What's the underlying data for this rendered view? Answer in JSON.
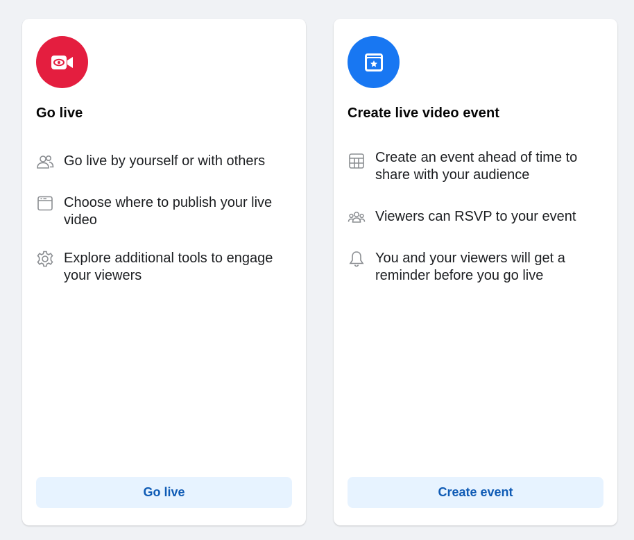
{
  "colors": {
    "page_bg": "#f0f2f5",
    "card_bg": "#ffffff",
    "go_live_accent": "#e41e3f",
    "event_accent": "#1877f2",
    "button_bg": "#e7f3ff",
    "button_text": "#0f5bb5",
    "feature_icon": "#8a8d91"
  },
  "go_live_card": {
    "icon": "video-camera-icon",
    "title": "Go live",
    "features": [
      {
        "icon": "people-icon",
        "text": "Go live by yourself or with others"
      },
      {
        "icon": "browser-window-icon",
        "text": "Choose where to publish your live video"
      },
      {
        "icon": "gear-icon",
        "text": "Explore additional tools to engage your viewers"
      }
    ],
    "button_label": "Go live"
  },
  "event_card": {
    "icon": "calendar-star-icon",
    "title": "Create live video event",
    "features": [
      {
        "icon": "table-grid-icon",
        "text": "Create an event ahead of time to share with your audience"
      },
      {
        "icon": "group-icon",
        "text": "Viewers can RSVP to your event"
      },
      {
        "icon": "bell-icon",
        "text": "You and your viewers will get a reminder before you go live"
      }
    ],
    "button_label": "Create event"
  }
}
